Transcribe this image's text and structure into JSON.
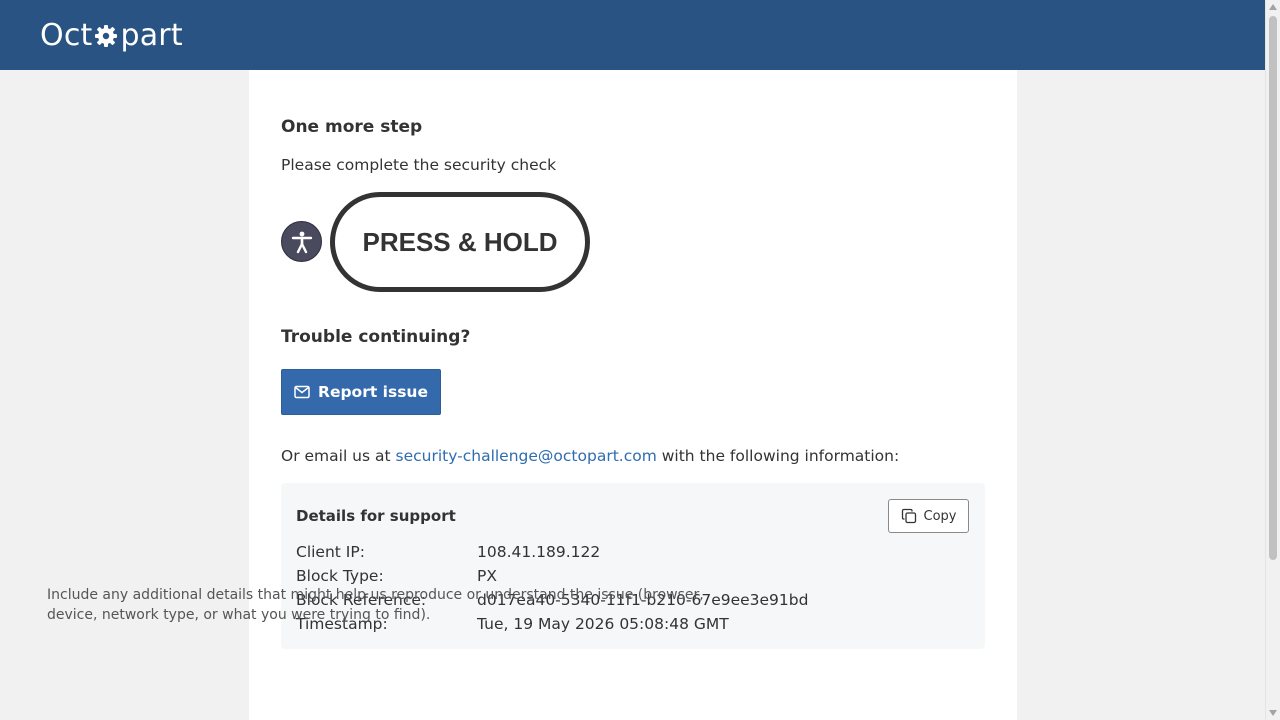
{
  "header": {
    "logo_prefix": "Oct",
    "logo_suffix": "part",
    "bg_color": "#285383"
  },
  "challenge": {
    "title": "One more step",
    "subtitle": "Please complete the security check",
    "accessibility_icon": "accessibility-icon",
    "press_hold_label": "PRESS & HOLD"
  },
  "trouble": {
    "title": "Trouble continuing?",
    "report_label": "Report issue",
    "report_icon": "mail-icon",
    "email_prefix": "Or email us at",
    "email": "security-challenge@octopart.com",
    "email_suffix": "with the following information:"
  },
  "support": {
    "title": "Details for support",
    "copy_label": "Copy",
    "copy_icon": "copy-icon",
    "rows": [
      {
        "label": "Client IP:",
        "value": "108.41.189.122"
      },
      {
        "label": "Block Type:",
        "value": "PX"
      },
      {
        "label": "Block Reference:",
        "value": "d017ea40-5340-11f1-b210-67e9ee3e91bd"
      },
      {
        "label": "Timestamp:",
        "value": "Tue, 19 May 2026 05:08:48 GMT"
      }
    ],
    "note": "Include any additional details that might help us reproduce or understand the issue (browser, device, network type, or what you were trying to find)."
  },
  "colors": {
    "accent": "#346aab",
    "link": "#2f6cb0",
    "text": "#333333"
  }
}
